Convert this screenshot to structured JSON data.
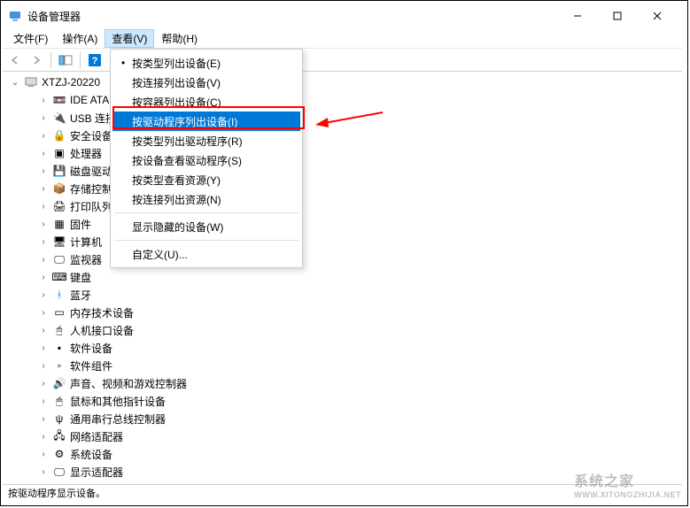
{
  "window": {
    "title": "设备管理器"
  },
  "menu": {
    "file": "文件(F)",
    "action": "操作(A)",
    "view": "查看(V)",
    "help": "帮助(H)"
  },
  "view_dropdown": {
    "by_type": "按类型列出设备(E)",
    "by_connection": "按连接列出设备(V)",
    "by_container": "按容器列出设备(C)",
    "by_driver": "按驱动程序列出设备(I)",
    "drivers_by_type": "按类型列出驱动程序(R)",
    "drivers_by_device": "按设备查看驱动程序(S)",
    "resources_by_type": "按类型查看资源(Y)",
    "resources_by_connection": "按连接列出资源(N)",
    "show_hidden": "显示隐藏的设备(W)",
    "customize": "自定义(U)..."
  },
  "tree": {
    "root": "XTZJ-20220",
    "items": [
      "IDE ATA",
      "USB 连接",
      "安全设备",
      "处理器",
      "磁盘驱动",
      "存储控制",
      "打印队列",
      "固件",
      "计算机",
      "监视器",
      "键盘",
      "蓝牙",
      "内存技术设备",
      "人机接口设备",
      "软件设备",
      "软件组件",
      "声音、视频和游戏控制器",
      "鼠标和其他指针设备",
      "通用串行总线控制器",
      "网络适配器",
      "系统设备",
      "显示适配器"
    ]
  },
  "statusbar": {
    "text": "按驱动程序显示设备。"
  },
  "watermark": {
    "main": "系统之家",
    "sub": "WWW.XITONGZHIJIA.NET"
  }
}
